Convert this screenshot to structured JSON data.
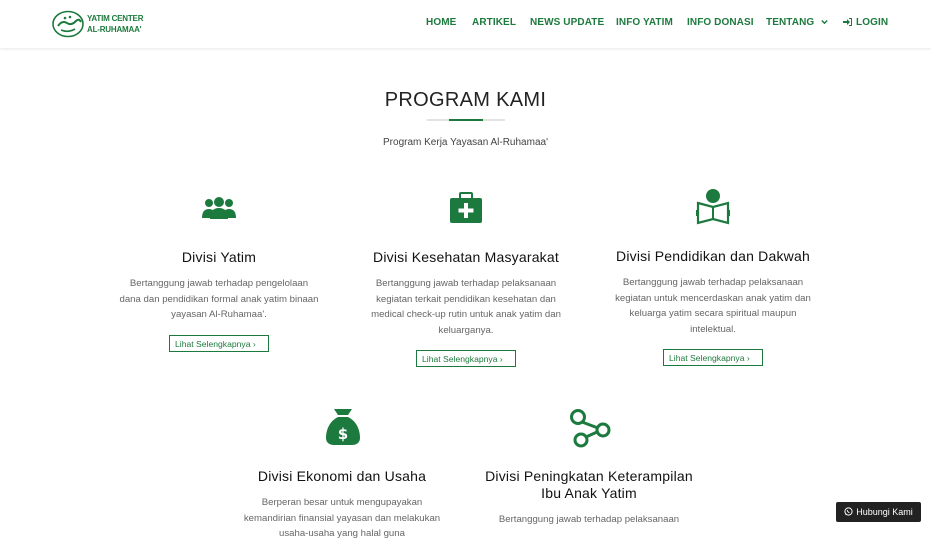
{
  "brand": {
    "line1": "YATIM CENTER",
    "line2": "AL-RUHAMAA'"
  },
  "nav": {
    "home": "HOME",
    "artikel": "ARTIKEL",
    "news": "NEWS UPDATE",
    "info_yatim": "INFO YATIM",
    "info_donasi": "INFO DONASI",
    "tentang": "TENTANG",
    "login": "LOGIN"
  },
  "section": {
    "title": "PROGRAM KAMI",
    "subtitle": "Program Kerja Yayasan Al-Ruhamaa'"
  },
  "programs": [
    {
      "title": "Divisi Yatim",
      "desc": [
        "Bertanggung jawab terhadap pengelolaan",
        "dana dan pendidikan formal anak yatim binaan",
        "yayasan Al-Ruhamaa'."
      ],
      "button": "Lihat Selengkapnya ›"
    },
    {
      "title": "Divisi Kesehatan Masyarakat",
      "desc": [
        "Bertanggung jawab terhadap pelaksanaan",
        "kegiatan terkait pendidikan kesehatan dan",
        "medical check-up rutin untuk anak yatim dan",
        "keluarganya."
      ],
      "button": "Lihat Selengkapnya ›"
    },
    {
      "title": "Divisi Pendidikan dan Dakwah",
      "desc": [
        "Bertanggung jawab terhadap pelaksanaan",
        "kegiatan untuk mencerdaskan anak yatim dan",
        "keluarga yatim secara spiritual maupun",
        "intelektual."
      ],
      "button": "Lihat Selengkapnya ›"
    },
    {
      "title": "Divisi Ekonomi dan Usaha",
      "desc": [
        "Berperan besar untuk mengupayakan",
        "kemandirian finansial yayasan dan melakukan",
        "usaha-usaha yang halal guna"
      ]
    },
    {
      "title_lines": [
        "Divisi Peningkatan Keterampilan",
        "Ibu Anak Yatim"
      ],
      "desc": [
        "Bertanggung jawab terhadap pelaksanaan"
      ]
    }
  ],
  "chat_button": "Hubungi Kami",
  "colors": {
    "accent": "#1d7a3e"
  },
  "icons": [
    "users-icon",
    "medical-kit-icon",
    "reading-book-icon",
    "money-bag-icon",
    "share-nodes-icon",
    "sign-in-icon",
    "whatsapp-icon"
  ]
}
